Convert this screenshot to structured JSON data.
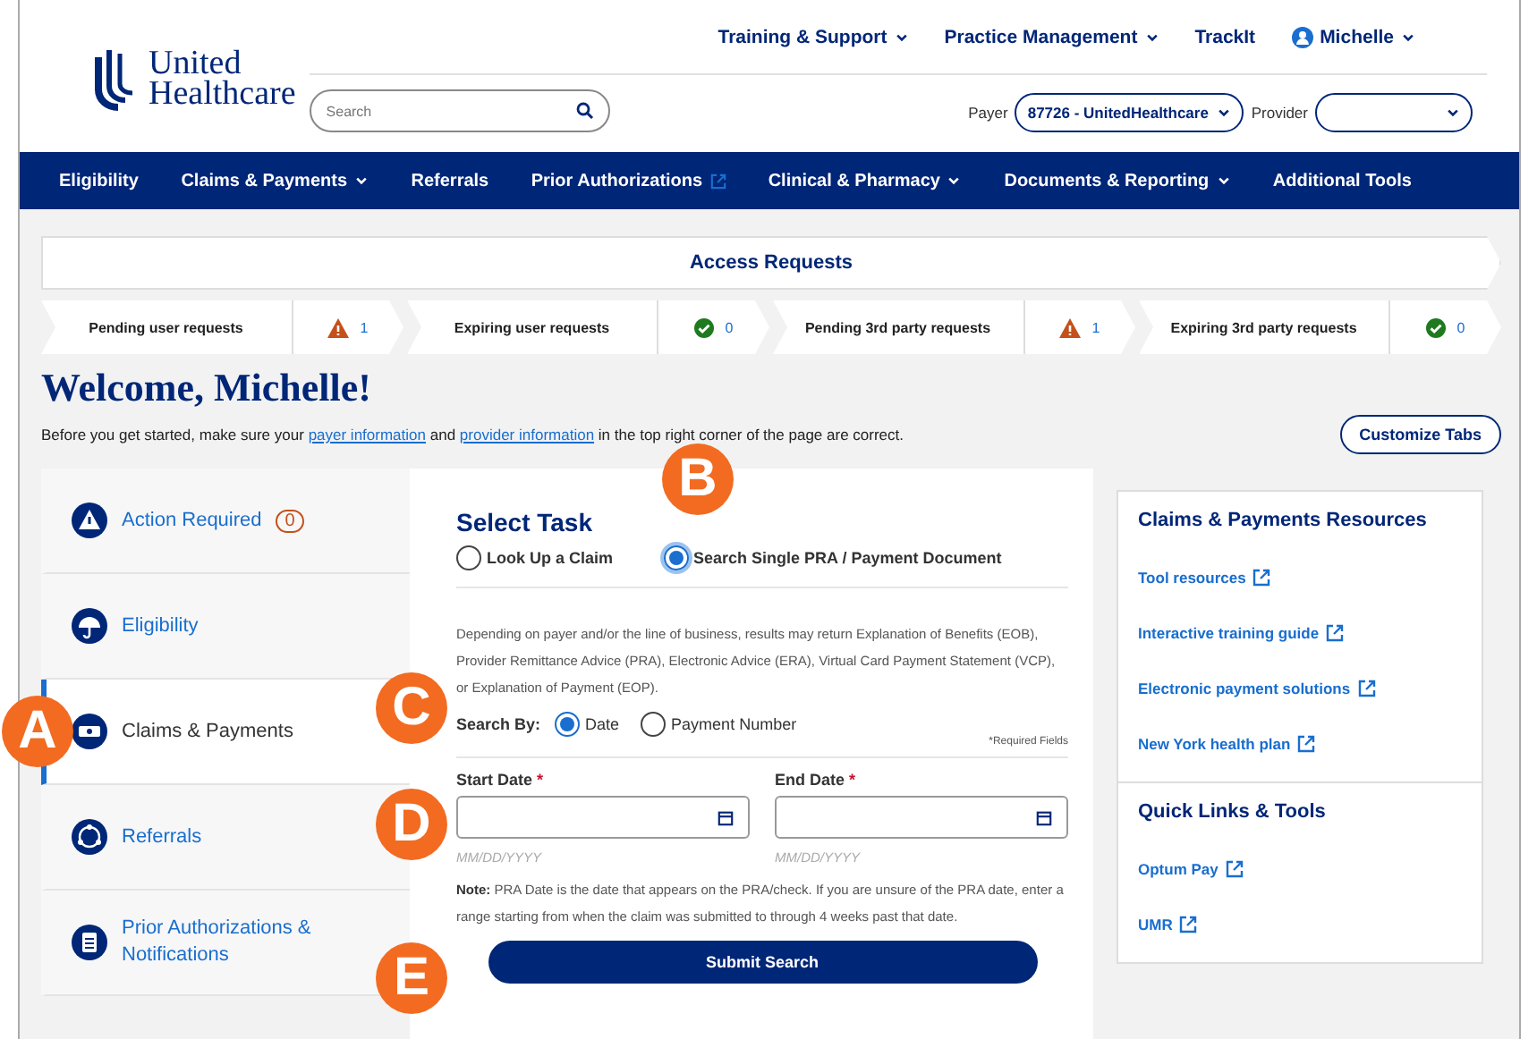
{
  "header": {
    "logo": {
      "line_1": "United",
      "line_2": "Healthcare"
    },
    "search": {
      "placeholder": "Search"
    },
    "top_links": [
      {
        "label": "Training & Support",
        "dropdown": true,
        "user": false
      },
      {
        "label": "Practice Management",
        "dropdown": true,
        "user": false
      },
      {
        "label": "TrackIt",
        "dropdown": false,
        "user": false
      },
      {
        "label": "Michelle",
        "dropdown": true,
        "user": true
      }
    ],
    "payer": {
      "label": "Payer",
      "value": "87726 - UnitedHealthcare"
    },
    "provider": {
      "label": "Provider"
    }
  },
  "nav": [
    {
      "label": "Eligibility",
      "dropdown": false,
      "external": false
    },
    {
      "label": "Claims & Payments",
      "dropdown": true,
      "external": false
    },
    {
      "label": "Referrals",
      "dropdown": false,
      "external": false
    },
    {
      "label": "Prior Authorizations",
      "dropdown": false,
      "external": true
    },
    {
      "label": "Clinical & Pharmacy",
      "dropdown": true,
      "external": false
    },
    {
      "label": "Documents & Reporting",
      "dropdown": true,
      "external": false
    },
    {
      "label": "Additional Tools",
      "dropdown": false,
      "external": false
    }
  ],
  "access_requests": {
    "title": "Access Requests",
    "steps": [
      {
        "label": "Pending user requests",
        "kind": "warning",
        "count": "1"
      },
      {
        "label": "Expiring user requests",
        "kind": "ok",
        "count": "0"
      },
      {
        "label": "Pending 3rd party requests",
        "kind": "warning",
        "count": "1"
      },
      {
        "label": "Expiring 3rd party requests",
        "kind": "ok",
        "count": "0"
      }
    ]
  },
  "welcome": {
    "title": "Welcome, Michelle!",
    "intro_before": "Before you get started, make sure your",
    "link_1": "payer information",
    "intro_middle": "and",
    "link_2": "provider information",
    "intro_after": "in the top right corner of the page are correct.",
    "customize_button": "Customize Tabs"
  },
  "sidebar": [
    {
      "label": "Action Required",
      "kind": "warning",
      "badge": "0",
      "selected": false
    },
    {
      "label": "Eligibility",
      "kind": "umbrella",
      "selected": false
    },
    {
      "label": "Claims & Payments",
      "kind": "money",
      "selected": true
    },
    {
      "label": "Referrals",
      "kind": "referral",
      "selected": false
    },
    {
      "label": "Prior Authorizations & Notifications",
      "kind": "clipboard",
      "selected": false
    }
  ],
  "task": {
    "title": "Select Task",
    "options": [
      {
        "label": "Look Up a Claim",
        "selected": false
      },
      {
        "label": "Search Single PRA / Payment Document",
        "selected": true
      }
    ],
    "description": "Depending on payer and/or the line of business, results may return Explanation of Benefits (EOB), Provider Remittance Advice (PRA), Electronic Advice (ERA), Virtual Card Payment Statement (VCP), or Explanation of Payment (EOP).",
    "search_by": {
      "label": "Search By:",
      "options": [
        {
          "label": "Date",
          "selected": true
        },
        {
          "label": "Payment Number",
          "selected": false
        }
      ]
    },
    "required_note": "*Required Fields",
    "required_mark": "*",
    "fields": [
      {
        "label": "Start Date",
        "required": true,
        "hint": "MM/DD/YYYY"
      },
      {
        "label": "End Date",
        "required": true,
        "hint": "MM/DD/YYYY"
      }
    ],
    "note": "**Note:** PRA Date is the date that appears on the PRA/check. If you are unsure of the PRA date, enter a range starting from when the claim was submitted to through 4 weeks past that date.",
    "submit": "Submit Search"
  },
  "resources": [
    {
      "title": "Claims & Payments Resources",
      "links": [
        "Tool resources",
        "Interactive training guide",
        "Electronic payment solutions",
        "New York health plan"
      ]
    },
    {
      "title": "Quick Links & Tools",
      "links": [
        "Optum Pay",
        "UMR"
      ]
    }
  ],
  "callouts": [
    {
      "label": "A"
    },
    {
      "label": "B"
    },
    {
      "label": "C"
    },
    {
      "label": "D"
    },
    {
      "label": "E"
    }
  ]
}
